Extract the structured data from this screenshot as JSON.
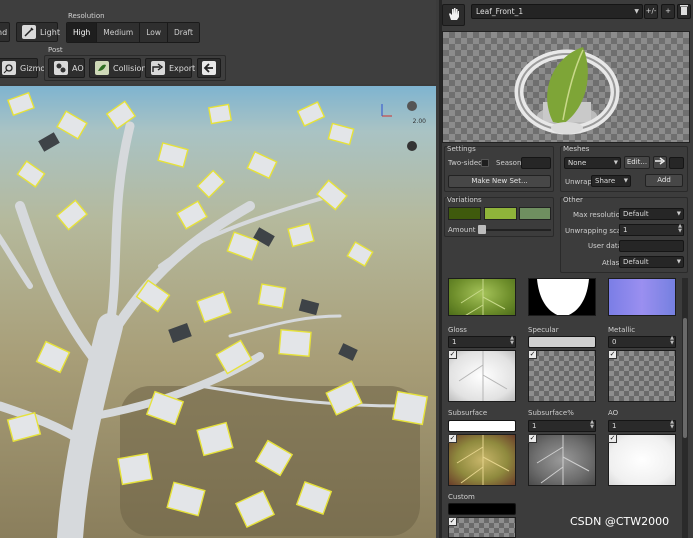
{
  "toolbar": {
    "wind_label": "nd",
    "light_label": "Light",
    "resolution_title": "Resolution",
    "resolution_options": [
      "High",
      "Medium",
      "Low",
      "Draft"
    ],
    "resolution_selected": "High",
    "gizmo_label": "Gizmo",
    "post_title": "Post",
    "ao_label": "AO",
    "collision_label": "Collision",
    "export_label": "Export"
  },
  "viewport": {
    "zoom_readout": "2.00"
  },
  "panel": {
    "selected_asset": "Leaf_Front_1",
    "plus_minus_label": "+/-",
    "add_label": "+",
    "settings": {
      "title": "Settings",
      "two_sided_label": "Two-sided",
      "season_label": "Season",
      "make_new_set_label": "Make New Set..."
    },
    "meshes": {
      "title": "Meshes",
      "mesh_value": "None",
      "edit_label": "Edit...",
      "unwrap_label": "Unwrap",
      "unwrap_value": "Share",
      "add_label": "Add"
    },
    "variations": {
      "title": "Variations",
      "amount_label": "Amount",
      "colors": [
        "#3f5a0d",
        "#8fb33a",
        "#6f8f60"
      ]
    },
    "other": {
      "title": "Other",
      "max_resolution_label": "Max resolution",
      "max_resolution_value": "Default",
      "unwrapping_scale_label": "Unwrapping scale",
      "unwrapping_scale_value": "1",
      "user_data_label": "User data",
      "user_data_value": "",
      "atlas_label": "Atlas",
      "atlas_value": "Default"
    },
    "maps": {
      "gloss_label": "Gloss",
      "gloss_value": "1",
      "specular_label": "Specular",
      "metallic_label": "Metallic",
      "metallic_value": "0",
      "subsurface_label": "Subsurface",
      "subsurface_pct_label": "Subsurface%",
      "subsurface_pct_value": "1",
      "ao_label": "AO",
      "ao_value": "1",
      "custom_label": "Custom"
    }
  },
  "watermark": "CSDN @CTW2000"
}
